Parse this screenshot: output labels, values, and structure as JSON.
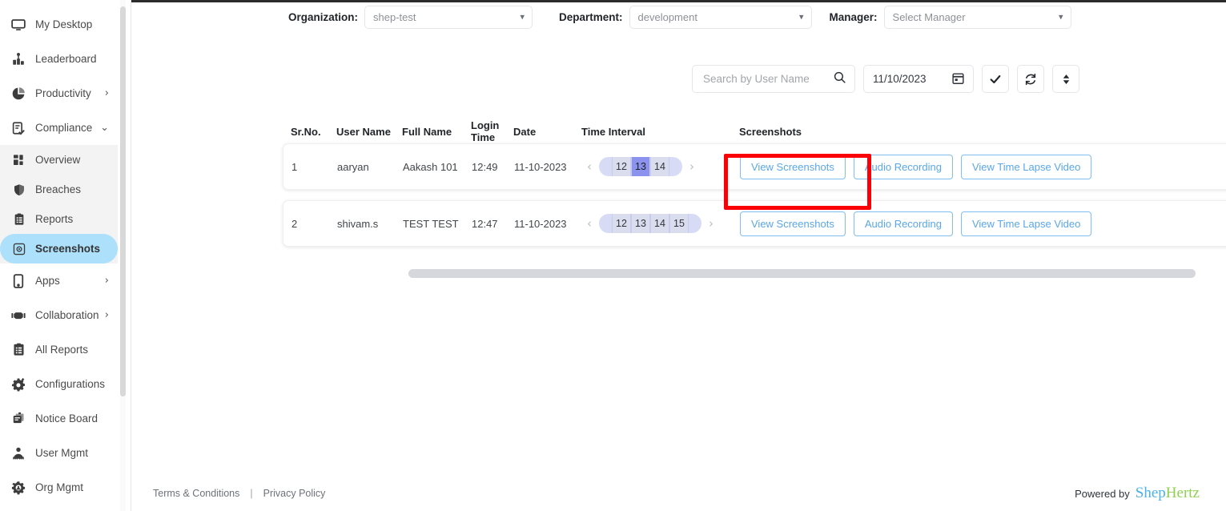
{
  "sidebar": {
    "items": [
      {
        "label": "My Desktop",
        "icon": "monitor-icon",
        "chevron": "",
        "level": "top"
      },
      {
        "label": "Leaderboard",
        "icon": "leaderboard-icon",
        "chevron": "",
        "level": "top"
      },
      {
        "label": "Productivity",
        "icon": "pie-chart-icon",
        "chevron": "›",
        "level": "top"
      },
      {
        "label": "Compliance",
        "icon": "clipboard-check-icon",
        "chevron": "⌄",
        "level": "top"
      },
      {
        "label": "Overview",
        "icon": "grid-icon",
        "chevron": "",
        "level": "sub"
      },
      {
        "label": "Breaches",
        "icon": "shield-icon",
        "chevron": "",
        "level": "sub"
      },
      {
        "label": "Reports",
        "icon": "report-icon",
        "chevron": "",
        "level": "sub"
      },
      {
        "label": "Screenshots",
        "icon": "camera-icon",
        "chevron": "",
        "level": "sub",
        "active": true
      },
      {
        "label": "Apps",
        "icon": "mobile-icon",
        "chevron": "›",
        "level": "top"
      },
      {
        "label": "Collaboration",
        "icon": "handshake-icon",
        "chevron": "›",
        "level": "top"
      },
      {
        "label": "All Reports",
        "icon": "all-reports-icon",
        "chevron": "",
        "level": "top"
      },
      {
        "label": "Configurations",
        "icon": "gear-plus-icon",
        "chevron": "",
        "level": "top"
      },
      {
        "label": "Notice Board",
        "icon": "notice-board-icon",
        "chevron": "",
        "level": "top"
      },
      {
        "label": "User Mgmt",
        "icon": "users-icon",
        "chevron": "",
        "level": "top"
      },
      {
        "label": "Org Mgmt",
        "icon": "org-gear-icon",
        "chevron": "",
        "level": "top"
      }
    ]
  },
  "filters": {
    "organization": {
      "label": "Organization:",
      "value": "shep-test"
    },
    "department": {
      "label": "Department:",
      "value": "development"
    },
    "manager": {
      "label": "Manager:",
      "value": "Select Manager"
    }
  },
  "toolbar": {
    "search_placeholder": "Search by User Name",
    "search_value": "",
    "date_value": "11/10/2023",
    "apply_label": "✔",
    "refresh_label": "↻",
    "sort_label": "↕"
  },
  "table": {
    "headers": [
      "Sr.No.",
      "User Name",
      "Full Name",
      "Login Time",
      "Date",
      "Time Interval",
      "Screenshots"
    ],
    "rows": [
      {
        "sr": "1",
        "user_name": "aaryan",
        "full_name": "Aakash 101",
        "login_time": "12:49",
        "date": "11-10-2023",
        "intervals": [
          "12",
          "13",
          "14"
        ],
        "selected_interval": "13",
        "highlighted": true,
        "actions": [
          "View Screenshots",
          "Audio Recording",
          "View Time Lapse Video"
        ]
      },
      {
        "sr": "2",
        "user_name": "shivam.s",
        "full_name": "TEST TEST",
        "login_time": "12:47",
        "date": "11-10-2023",
        "intervals": [
          "12",
          "13",
          "14",
          "15"
        ],
        "selected_interval": "",
        "highlighted": false,
        "actions": [
          "View Screenshots",
          "Audio Recording",
          "View Time Lapse Video"
        ]
      }
    ],
    "prev_arrow": "‹",
    "next_arrow": "›"
  },
  "footer": {
    "terms": "Terms & Conditions",
    "separator": "|",
    "privacy": "Privacy Policy",
    "powered_by": "Powered by",
    "brand_part1": "Shep",
    "brand_part2": "Hertz"
  },
  "colors": {
    "accent_blue": "#5aa7e8",
    "active_nav": "#ace0fb",
    "pill_bg": "#d8dbf5",
    "pill_selected": "#8b93ef",
    "highlight_red": "#fb0006",
    "brand_blue": "#4ab2ea",
    "brand_green": "#8fd14f"
  }
}
